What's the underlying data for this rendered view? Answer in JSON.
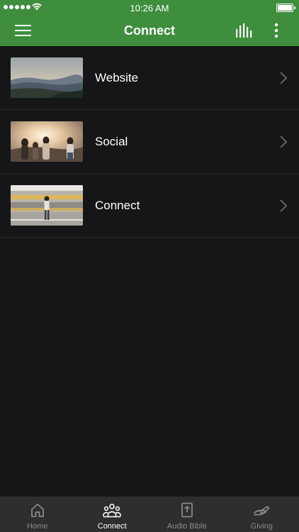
{
  "status_bar": {
    "time": "10:26 AM"
  },
  "header": {
    "title": "Connect"
  },
  "list": {
    "items": [
      {
        "label": "Website",
        "thumb": "mountain-landscape"
      },
      {
        "label": "Social",
        "thumb": "friends-sunset"
      },
      {
        "label": "Connect",
        "thumb": "train-station"
      }
    ]
  },
  "tabs": [
    {
      "label": "Home",
      "icon": "home-icon",
      "active": false
    },
    {
      "label": "Connect",
      "icon": "people-icon",
      "active": true
    },
    {
      "label": "Audio Bible",
      "icon": "bible-icon",
      "active": false
    },
    {
      "label": "Giving",
      "icon": "giving-hand-icon",
      "active": false
    }
  ],
  "colors": {
    "accent": "#3e8e3e",
    "background": "#161618",
    "tabbar": "#2e2e31"
  }
}
